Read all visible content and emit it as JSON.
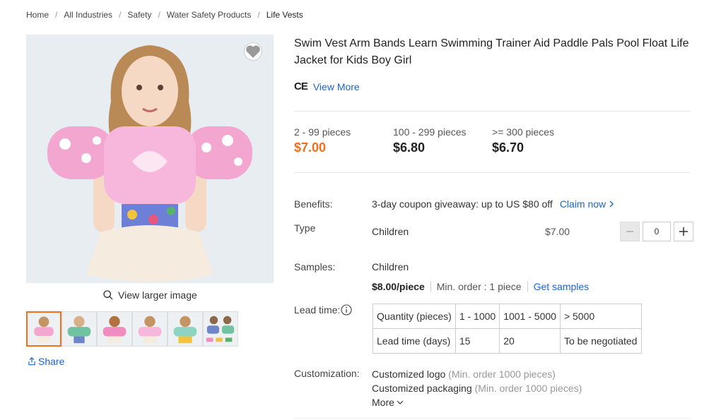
{
  "breadcrumb": {
    "items": [
      "Home",
      "All Industries",
      "Safety",
      "Water Safety Products",
      "Life Vests"
    ],
    "separator": "/"
  },
  "gallery": {
    "view_larger_label": "View larger image",
    "share_label": "Share",
    "thumbnail_count": 6,
    "active_thumbnail": 1
  },
  "product": {
    "title": "Swim Vest Arm Bands Learn Swimming Trainer Aid Paddle Pals Pool Float Life Jacket for Kids Boy Girl",
    "cert_mark": "CE",
    "view_more": "View More"
  },
  "price_tiers": [
    {
      "qty": "2 - 99 pieces",
      "price": "$7.00"
    },
    {
      "qty": "100 - 299 pieces",
      "price": "$6.80"
    },
    {
      "qty": ">= 300 pieces",
      "price": "$6.70"
    }
  ],
  "benefits": {
    "label": "Benefits:",
    "text": "3-day coupon giveaway: up to US $80 off",
    "claim_label": "Claim now"
  },
  "type": {
    "label": "Type",
    "option": "Children",
    "price": "$7.00",
    "quantity": "0"
  },
  "samples": {
    "label": "Samples:",
    "option": "Children",
    "price": "$8.00/piece",
    "min_order": "Min. order : 1 piece",
    "get_samples": "Get samples"
  },
  "lead_time": {
    "label": "Lead time:",
    "rows": [
      [
        "Quantity (pieces)",
        "1 - 1000",
        "1001 - 5000",
        "> 5000"
      ],
      [
        "Lead time (days)",
        "15",
        "20",
        "To be negotiated"
      ]
    ]
  },
  "customization": {
    "label": "Customization:",
    "items": [
      {
        "name": "Customized logo",
        "note": "(Min. order 1000 pieces)"
      },
      {
        "name": "Customized packaging",
        "note": "(Min. order 1000 pieces)"
      }
    ],
    "more_label": "More"
  },
  "colors": {
    "accent_orange": "#f56e1e",
    "link_blue": "#1a66cc",
    "vest_pink": "#f3a6d0"
  }
}
